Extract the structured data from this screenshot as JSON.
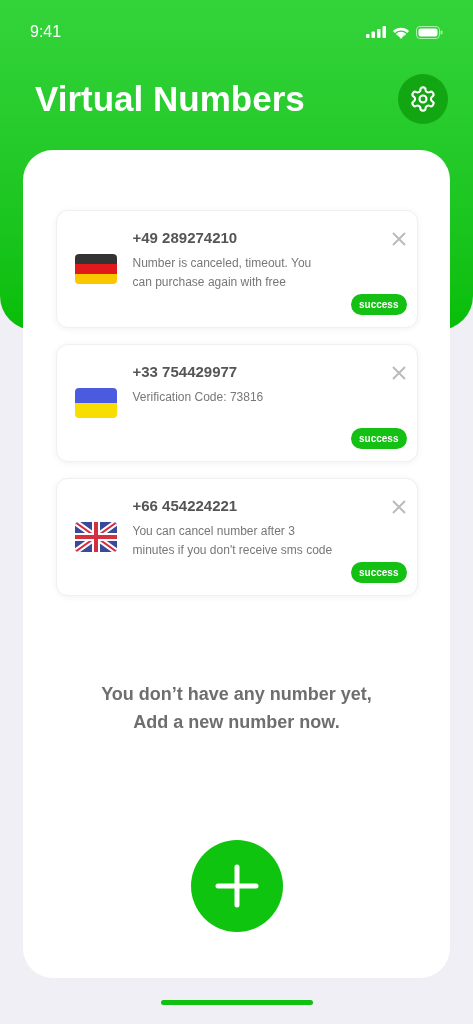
{
  "status_bar": {
    "time": "9:41"
  },
  "header": {
    "title": "Virtual Numbers"
  },
  "numbers": [
    {
      "kind": "germany",
      "number": "+49 289274210",
      "message": "Number is canceled, timeout. You can purchase again with free",
      "status": "success"
    },
    {
      "kind": "ukraine",
      "number": "+33 754429977",
      "message": "Verification Code: 73816",
      "status": "success"
    },
    {
      "kind": "uk",
      "number": "+66 454224221",
      "message": "You can cancel number after 3 minutes if you don't receive sms code",
      "status": "success"
    }
  ],
  "empty_message": [
    "You don’t have any number yet,",
    "Add a new number now."
  ]
}
